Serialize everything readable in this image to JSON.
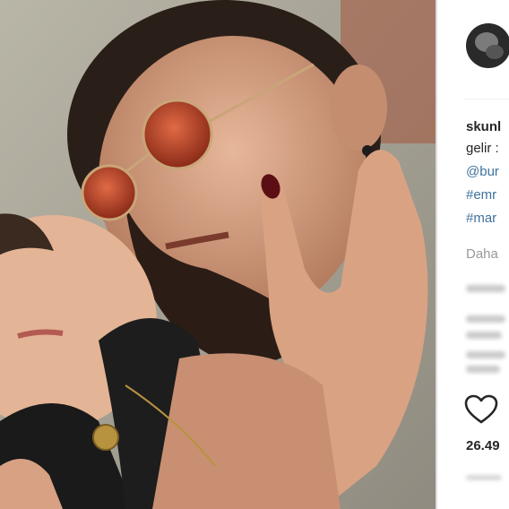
{
  "post": {
    "photo_icon": "photo-couple-image",
    "username": "skunl",
    "caption_start": "gelir :",
    "mention": "@bur",
    "hashtags": [
      "#emr",
      "#mar"
    ],
    "more_label": "Daha",
    "like_icon": "heart-outline-icon",
    "likes": "26.49"
  },
  "colors": {
    "link": "#3f729b",
    "text": "#262626",
    "muted": "#999999"
  }
}
